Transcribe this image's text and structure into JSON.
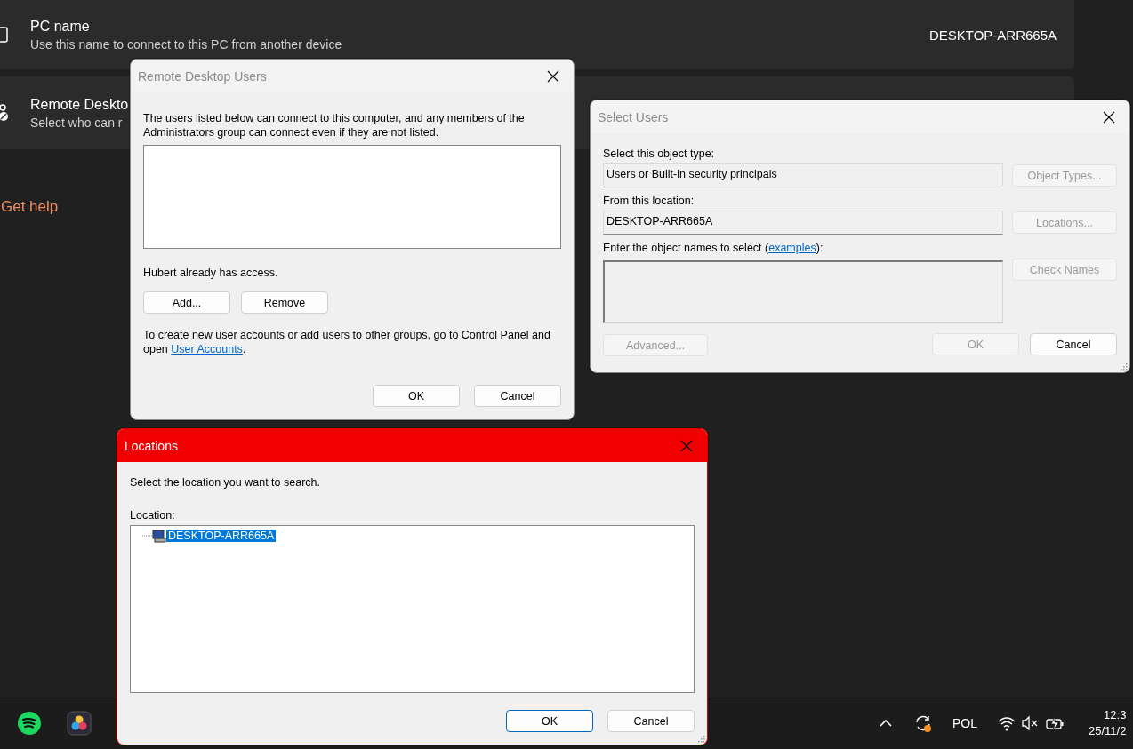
{
  "settings": {
    "cards": [
      {
        "title": "PC name",
        "subtitle": "Use this name to connect to this PC from another device",
        "value": "DESKTOP-ARR665A",
        "kind": "name"
      },
      {
        "title": "Remote Deskto",
        "subtitle": "Select who can r",
        "kind": "users"
      }
    ],
    "help_link": "Get help"
  },
  "remote_desktop_users": {
    "title": "Remote Desktop Users",
    "active": false,
    "description": "The users listed below can connect to this computer, and any members of the Administrators group can connect even if they are not listed.",
    "access_note": "Hubert already has access.",
    "buttons": [
      {
        "label": "Add...",
        "disabled": false
      },
      {
        "label": "Remove",
        "disabled": false
      }
    ],
    "footer_text": "To create new user accounts or add users to other groups, go to Control Panel and open ",
    "footer_link": "User Accounts",
    "footer_end": ".",
    "dialog_buttons": [
      {
        "label": "OK",
        "disabled": false,
        "default": false
      },
      {
        "label": "Cancel",
        "disabled": false,
        "default": false
      }
    ]
  },
  "select_users": {
    "title": "Select Users",
    "active": false,
    "rows": [
      {
        "label": "Select this object type:",
        "value": "Users or Built-in security principals",
        "button": {
          "label": "Object Types...",
          "disabled": true
        },
        "kind": "field"
      },
      {
        "label": "From this location:",
        "value": "DESKTOP-ARR665A",
        "button": {
          "label": "Locations...",
          "disabled": true
        },
        "kind": "field"
      },
      {
        "label": "Enter the object names to select (",
        "link": "examples",
        "label_end": "):",
        "button": {
          "label": "Check Names",
          "disabled": true
        },
        "kind": "textarea"
      }
    ],
    "advanced": {
      "label": "Advanced...",
      "disabled": true
    },
    "dialog_buttons": [
      {
        "label": "OK",
        "disabled": true,
        "default": false
      },
      {
        "label": "Cancel",
        "disabled": false,
        "default": false
      }
    ]
  },
  "locations": {
    "title": "Locations",
    "active": true,
    "description": "Select the location you want to search.",
    "tree_label": "Location:",
    "tree": [
      {
        "label": "DESKTOP-ARR665A",
        "selected": true
      }
    ],
    "dialog_buttons": [
      {
        "label": "OK",
        "disabled": false,
        "default": true
      },
      {
        "label": "Cancel",
        "disabled": false,
        "default": false
      }
    ]
  },
  "taskbar": {
    "language": "POL",
    "time": "12:3",
    "date": "25/11/2"
  }
}
